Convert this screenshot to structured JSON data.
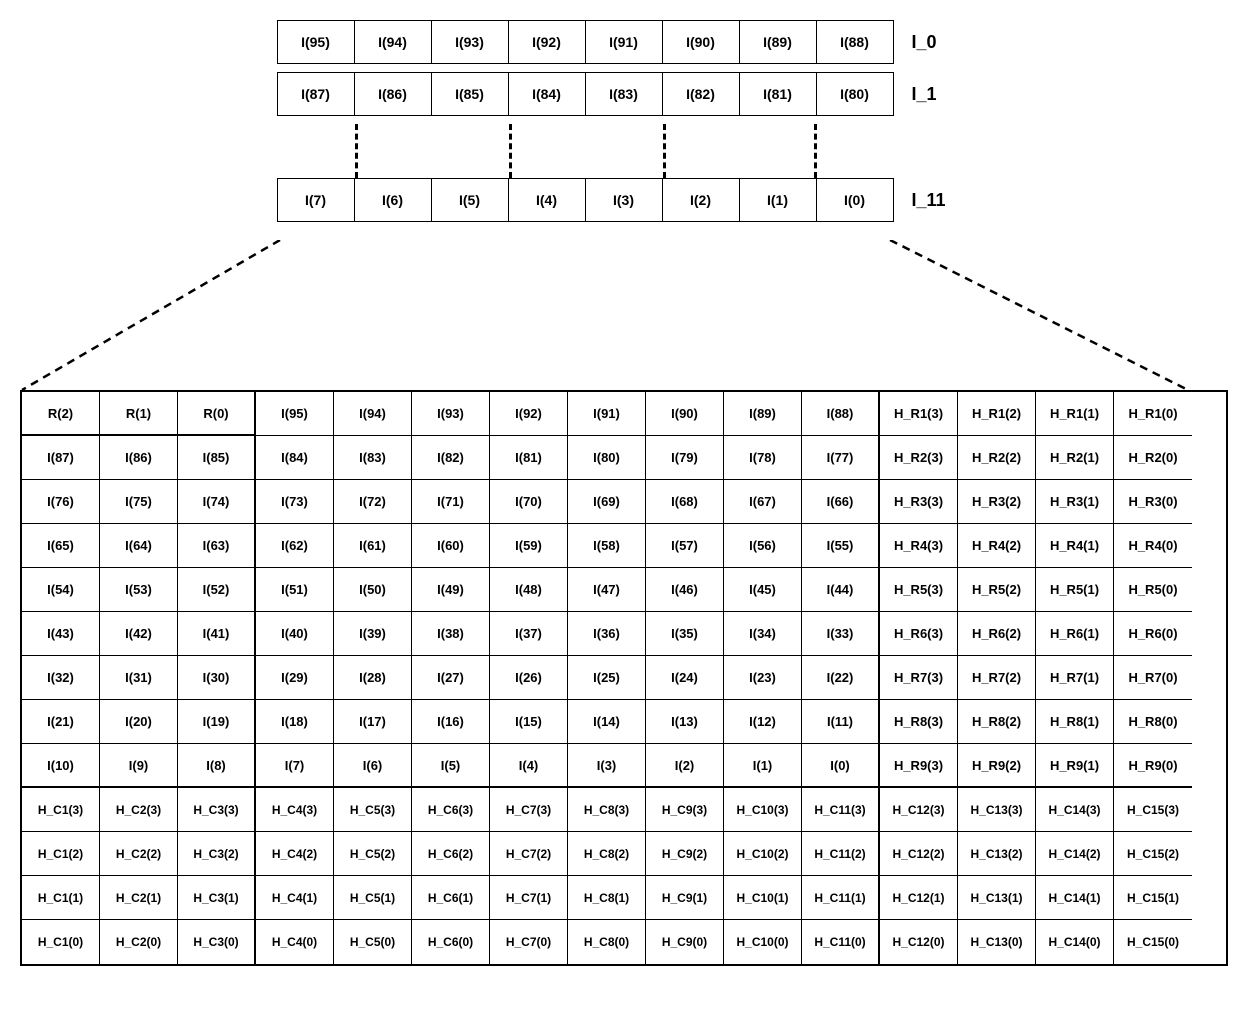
{
  "top_rows": [
    {
      "label": "I_0",
      "cells": [
        "I(95)",
        "I(94)",
        "I(93)",
        "I(92)",
        "I(91)",
        "I(90)",
        "I(89)",
        "I(88)"
      ]
    },
    {
      "label": "I_1",
      "cells": [
        "I(87)",
        "I(86)",
        "I(85)",
        "I(84)",
        "I(83)",
        "I(82)",
        "I(81)",
        "I(80)"
      ]
    },
    {
      "label": "I_11",
      "cells": [
        "I(7)",
        "I(6)",
        "I(5)",
        "I(4)",
        "I(3)",
        "I(2)",
        "I(1)",
        "I(0)"
      ]
    }
  ],
  "big_table": [
    [
      "R(2)",
      "R(1)",
      "R(0)",
      "I(95)",
      "I(94)",
      "I(93)",
      "I(92)",
      "I(91)",
      "I(90)",
      "I(89)",
      "I(88)",
      "H_R1(3)",
      "H_R1(2)",
      "H_R1(1)",
      "H_R1(0)"
    ],
    [
      "I(87)",
      "I(86)",
      "I(85)",
      "I(84)",
      "I(83)",
      "I(82)",
      "I(81)",
      "I(80)",
      "I(79)",
      "I(78)",
      "I(77)",
      "H_R2(3)",
      "H_R2(2)",
      "H_R2(1)",
      "H_R2(0)"
    ],
    [
      "I(76)",
      "I(75)",
      "I(74)",
      "I(73)",
      "I(72)",
      "I(71)",
      "I(70)",
      "I(69)",
      "I(68)",
      "I(67)",
      "I(66)",
      "H_R3(3)",
      "H_R3(2)",
      "H_R3(1)",
      "H_R3(0)"
    ],
    [
      "I(65)",
      "I(64)",
      "I(63)",
      "I(62)",
      "I(61)",
      "I(60)",
      "I(59)",
      "I(58)",
      "I(57)",
      "I(56)",
      "I(55)",
      "H_R4(3)",
      "H_R4(2)",
      "H_R4(1)",
      "H_R4(0)"
    ],
    [
      "I(54)",
      "I(53)",
      "I(52)",
      "I(51)",
      "I(50)",
      "I(49)",
      "I(48)",
      "I(47)",
      "I(46)",
      "I(45)",
      "I(44)",
      "H_R5(3)",
      "H_R5(2)",
      "H_R5(1)",
      "H_R5(0)"
    ],
    [
      "I(43)",
      "I(42)",
      "I(41)",
      "I(40)",
      "I(39)",
      "I(38)",
      "I(37)",
      "I(36)",
      "I(35)",
      "I(34)",
      "I(33)",
      "H_R6(3)",
      "H_R6(2)",
      "H_R6(1)",
      "H_R6(0)"
    ],
    [
      "I(32)",
      "I(31)",
      "I(30)",
      "I(29)",
      "I(28)",
      "I(27)",
      "I(26)",
      "I(25)",
      "I(24)",
      "I(23)",
      "I(22)",
      "H_R7(3)",
      "H_R7(2)",
      "H_R7(1)",
      "H_R7(0)"
    ],
    [
      "I(21)",
      "I(20)",
      "I(19)",
      "I(18)",
      "I(17)",
      "I(16)",
      "I(15)",
      "I(14)",
      "I(13)",
      "I(12)",
      "I(11)",
      "H_R8(3)",
      "H_R8(2)",
      "H_R8(1)",
      "H_R8(0)"
    ],
    [
      "I(10)",
      "I(9)",
      "I(8)",
      "I(7)",
      "I(6)",
      "I(5)",
      "I(4)",
      "I(3)",
      "I(2)",
      "I(1)",
      "I(0)",
      "H_R9(3)",
      "H_R9(2)",
      "H_R9(1)",
      "H_R9(0)"
    ],
    [
      "H_C1(3)",
      "H_C2(3)",
      "H_C3(3)",
      "H_C4(3)",
      "H_C5(3)",
      "H_C6(3)",
      "H_C7(3)",
      "H_C8(3)",
      "H_C9(3)",
      "H_C10(3)",
      "H_C11(3)",
      "H_C12(3)",
      "H_C13(3)",
      "H_C14(3)",
      "H_C15(3)"
    ],
    [
      "H_C1(2)",
      "H_C2(2)",
      "H_C3(2)",
      "H_C4(2)",
      "H_C5(2)",
      "H_C6(2)",
      "H_C7(2)",
      "H_C8(2)",
      "H_C9(2)",
      "H_C10(2)",
      "H_C11(2)",
      "H_C12(2)",
      "H_C13(2)",
      "H_C14(2)",
      "H_C15(2)"
    ],
    [
      "H_C1(1)",
      "H_C2(1)",
      "H_C3(1)",
      "H_C4(1)",
      "H_C5(1)",
      "H_C6(1)",
      "H_C7(1)",
      "H_C8(1)",
      "H_C9(1)",
      "H_C10(1)",
      "H_C11(1)",
      "H_C12(1)",
      "H_C13(1)",
      "H_C14(1)",
      "H_C15(1)"
    ],
    [
      "H_C1(0)",
      "H_C2(0)",
      "H_C3(0)",
      "H_C4(0)",
      "H_C5(0)",
      "H_C6(0)",
      "H_C7(0)",
      "H_C8(0)",
      "H_C9(0)",
      "H_C10(0)",
      "H_C11(0)",
      "H_C12(0)",
      "H_C13(0)",
      "H_C14(0)",
      "H_C15(0)"
    ]
  ],
  "thick_right_cols": [
    2,
    10
  ],
  "row0_thick_bottom_first3": true,
  "row8_thick_bottom_all": true,
  "hc_rows_start": 9
}
